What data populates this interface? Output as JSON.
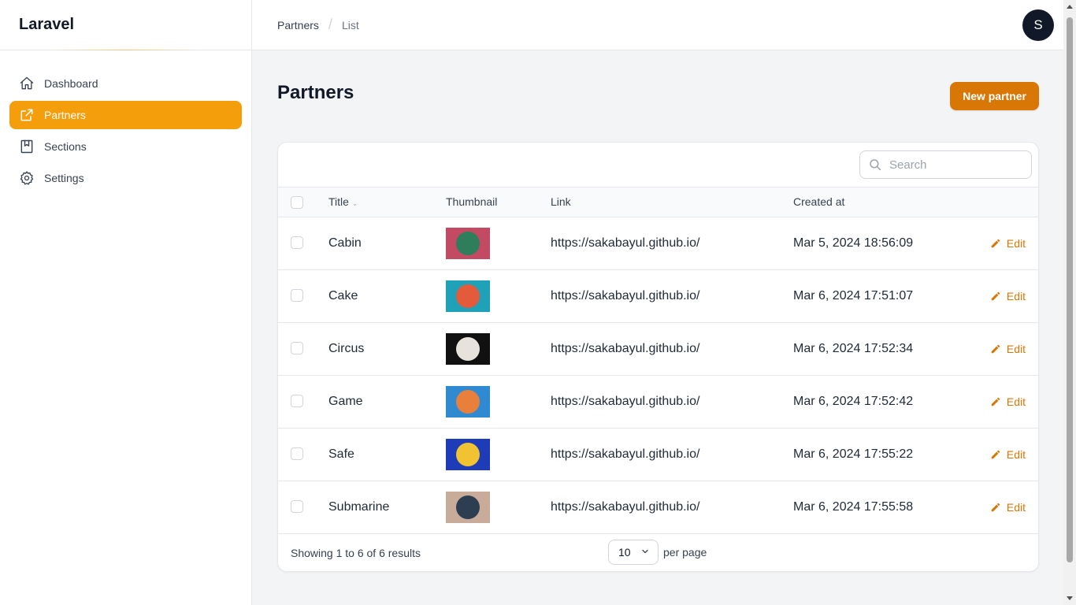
{
  "app": {
    "brand": "Laravel",
    "avatar_initial": "S"
  },
  "sidebar": {
    "items": [
      {
        "label": "Dashboard",
        "icon": "home-icon",
        "active": false
      },
      {
        "label": "Partners",
        "icon": "external-link-icon",
        "active": true
      },
      {
        "label": "Sections",
        "icon": "book-icon",
        "active": false
      },
      {
        "label": "Settings",
        "icon": "gear-icon",
        "active": false
      }
    ]
  },
  "breadcrumb": {
    "items": [
      "Partners",
      "List"
    ],
    "separator": "/"
  },
  "page": {
    "title": "Partners",
    "new_button": "New partner"
  },
  "search": {
    "placeholder": "Search"
  },
  "table": {
    "columns": {
      "title": "Title",
      "thumbnail": "Thumbnail",
      "link": "Link",
      "created_at": "Created at"
    },
    "edit_label": "Edit",
    "rows": [
      {
        "title": "Cabin",
        "thumb_bg": "#c24b63",
        "thumb_fg": "#2e7d5b",
        "link": "https://sakabayul.github.io/",
        "created_at": "Mar 5, 2024 18:56:09"
      },
      {
        "title": "Cake",
        "thumb_bg": "#1fa2b8",
        "thumb_fg": "#e45b3c",
        "link": "https://sakabayul.github.io/",
        "created_at": "Mar 6, 2024 17:51:07"
      },
      {
        "title": "Circus",
        "thumb_bg": "#111111",
        "thumb_fg": "#e8e2dc",
        "link": "https://sakabayul.github.io/",
        "created_at": "Mar 6, 2024 17:52:34"
      },
      {
        "title": "Game",
        "thumb_bg": "#2f8ad1",
        "thumb_fg": "#e87f3a",
        "link": "https://sakabayul.github.io/",
        "created_at": "Mar 6, 2024 17:52:42"
      },
      {
        "title": "Safe",
        "thumb_bg": "#1e3bb8",
        "thumb_fg": "#f1c232",
        "link": "https://sakabayul.github.io/",
        "created_at": "Mar 6, 2024 17:55:22"
      },
      {
        "title": "Submarine",
        "thumb_bg": "#c8ab99",
        "thumb_fg": "#2c3e50",
        "link": "https://sakabayul.github.io/",
        "created_at": "Mar 6, 2024 17:55:58"
      }
    ]
  },
  "footer": {
    "showing": "Showing 1 to 6 of 6 results",
    "per_page_value": "10",
    "per_page_label": "per page"
  },
  "colors": {
    "accent": "#f59e0b",
    "accent_dark": "#d97706"
  }
}
